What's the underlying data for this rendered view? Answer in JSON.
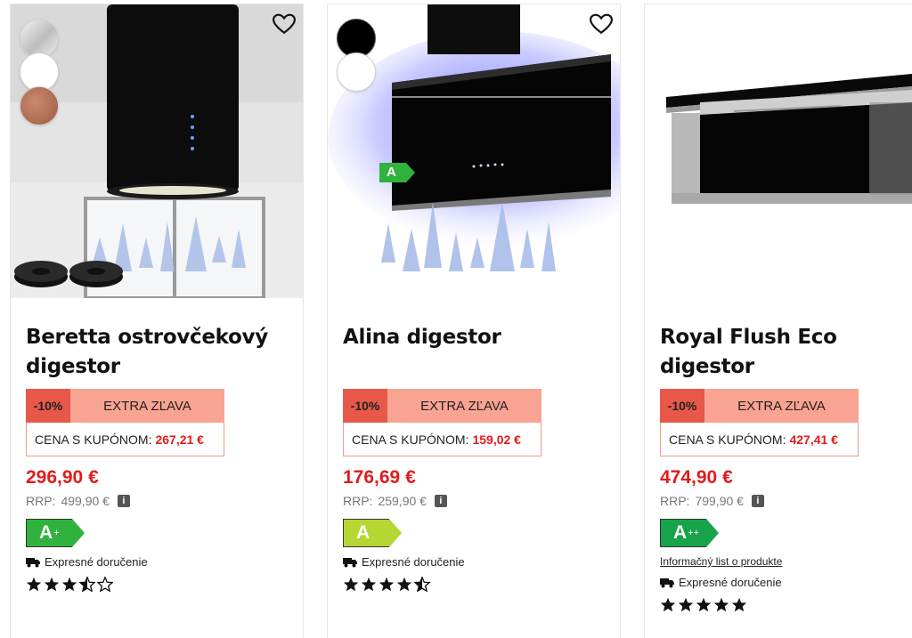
{
  "colors": {
    "accent_red": "#e11b1b",
    "discount_bg": "#e8584a",
    "extra_bg": "#f9a392",
    "energy_a_plus_plus": "#17a34a",
    "energy_a_plus": "#2fb33e",
    "energy_a": "#b6d634"
  },
  "products": [
    {
      "title": "Beretta ostrovčekový digestor",
      "swatches": [
        "silver",
        "white",
        "copper"
      ],
      "discount": "-10%",
      "extra": "EXTRA ZĽAVA",
      "coupon_label": "CENA S KUPÓNOM:",
      "coupon_price": "267,21 €",
      "price": "296,90 €",
      "rrp_label": "RRP:",
      "rrp": "499,90 €",
      "info_icon": "i",
      "energy_class": "A",
      "energy_sup": "+",
      "delivery": "Expresné doručenie",
      "rating": 3.5
    },
    {
      "title": "Alina digestor",
      "swatches": [
        "black",
        "white"
      ],
      "discount": "-10%",
      "extra": "EXTRA ZĽAVA",
      "coupon_label": "CENA S KUPÓNOM:",
      "coupon_price": "159,02 €",
      "price": "176,69 €",
      "rrp_label": "RRP:",
      "rrp": "259,90 €",
      "info_icon": "i",
      "energy_class": "A",
      "energy_sup": "",
      "image_badge": "A",
      "delivery": "Expresné doručenie",
      "rating": 4.5
    },
    {
      "title": "Royal Flush Eco digestor",
      "discount": "-10%",
      "extra": "EXTRA ZĽAVA",
      "coupon_label": "CENA S KUPÓNOM:",
      "coupon_price": "427,41 €",
      "price": "474,90 €",
      "rrp_label": "RRP:",
      "rrp": "799,90 €",
      "info_icon": "i",
      "energy_class": "A",
      "energy_sup": "++",
      "product_sheet": "Informačný list o produkte",
      "delivery": "Expresné doručenie",
      "rating": 5
    }
  ]
}
